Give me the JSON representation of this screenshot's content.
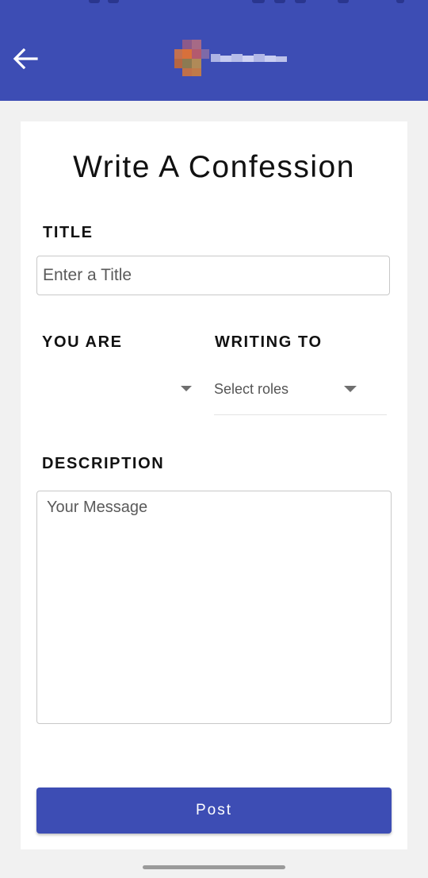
{
  "colors": {
    "primary": "#3d4db4",
    "background": "#f1f1f1",
    "card": "#ffffff"
  },
  "appbar": {
    "back_icon": "arrow-left-icon",
    "logo_icon": "app-logo-icon"
  },
  "page": {
    "title": "Write A Confession"
  },
  "form": {
    "title_label": "TITLE",
    "title_placeholder": "Enter a Title",
    "title_value": "",
    "you_are_label": "YOU ARE",
    "you_are_value": "",
    "writing_to_label": "WRITING TO",
    "writing_to_value": "Select roles",
    "description_label": "DESCRIPTION",
    "description_placeholder": "Your Message",
    "description_value": "",
    "post_label": "Post"
  }
}
